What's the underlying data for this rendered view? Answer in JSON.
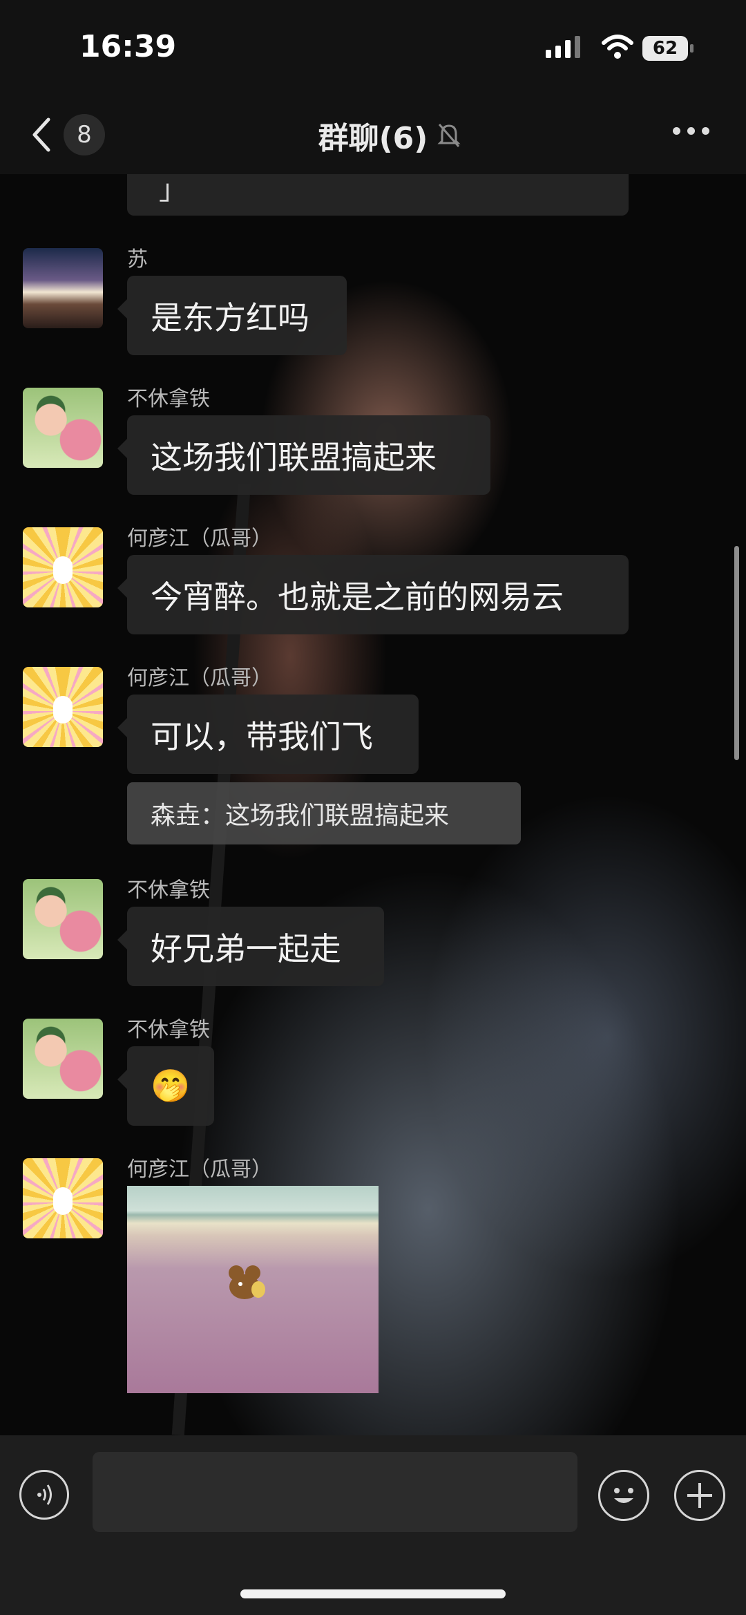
{
  "status_bar": {
    "time": "16:39",
    "battery": "62"
  },
  "nav": {
    "back_count": "8",
    "title": "群聊(6)"
  },
  "messages": [
    {
      "sender": "苏",
      "text": "是东方红吗"
    },
    {
      "sender": "不休拿铁",
      "text": "这场我们联盟搞起来"
    },
    {
      "sender": "何彦江（瓜哥）",
      "text": "今宵醉。也就是之前的网易云"
    },
    {
      "sender": "何彦江（瓜哥）",
      "text": "可以，带我们飞",
      "quote": "森垚：这场我们联盟搞起来"
    },
    {
      "sender": "不休拿铁",
      "text": "好兄弟一起走"
    },
    {
      "sender": "不休拿铁",
      "text": "🤭"
    },
    {
      "sender": "何彦江（瓜哥）",
      "image": "tom-and-jerry-sticker"
    }
  ],
  "partial_top_text": "」",
  "icons": {
    "back": "chevron-left-icon",
    "mute": "bell-muted-icon",
    "more": "more-icon",
    "voice": "voice-icon",
    "emoji": "emoji-icon",
    "plus": "plus-icon"
  }
}
